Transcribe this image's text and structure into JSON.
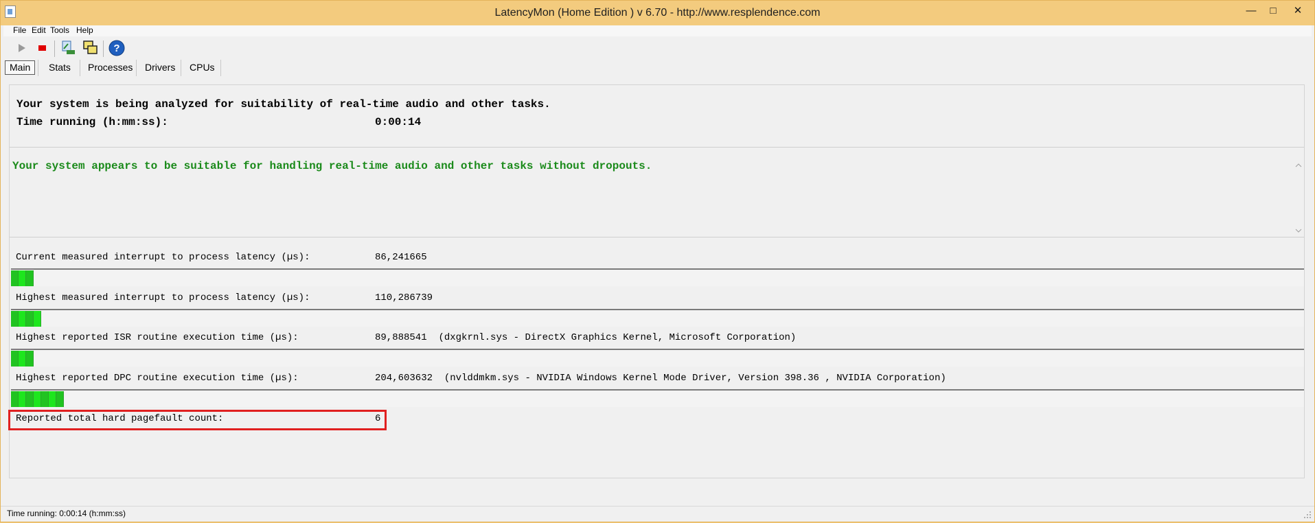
{
  "window": {
    "title": "LatencyMon  (Home Edition )  v 6.70 - http://www.resplendence.com",
    "controls": {
      "minimize": "—",
      "maximize": "□",
      "close": "✕"
    }
  },
  "menu": [
    "File",
    "Edit",
    "Tools",
    "Help"
  ],
  "toolbar": {
    "buttons": [
      "play-icon",
      "stop-icon",
      "gauge-icon",
      "windows-icon",
      "help-icon"
    ],
    "colors": {
      "stop": "#e00000",
      "help": "#1f5fbf",
      "play": "#9a9a9a"
    }
  },
  "tabs": [
    "Main",
    "Stats",
    "Processes",
    "Drivers",
    "CPUs"
  ],
  "header": {
    "line1": "Your system is being analyzed for suitability of real-time audio and other tasks.",
    "time_label": "Time running (h:mm:ss):",
    "time_value": "0:00:14"
  },
  "verdict": {
    "text": "Your system appears to be suitable for handling real-time audio and other tasks without dropouts.",
    "color": "#1a8a1a"
  },
  "metrics": [
    {
      "label": "Current measured interrupt to process latency (µs):",
      "value": "86,241665",
      "detail": "",
      "bar_segments": 3
    },
    {
      "label": "Highest measured interrupt to process latency (µs):",
      "value": "110,286739",
      "detail": "",
      "bar_segments": 4
    },
    {
      "label": "Highest reported ISR routine execution time (µs):",
      "value": "89,888541",
      "detail": "(dxgkrnl.sys - DirectX Graphics Kernel, Microsoft Corporation)",
      "bar_segments": 3
    },
    {
      "label": "Highest reported DPC routine execution time (µs):",
      "value": "204,603632",
      "detail": "(nvlddmkm.sys - NVIDIA Windows Kernel Mode Driver, Version 398.36 , NVIDIA Corporation)",
      "bar_segments": 7
    }
  ],
  "pagefault": {
    "label": "Reported total hard pagefault count:",
    "value": "6",
    "highlight_color": "#e02020"
  },
  "status": {
    "text": "Time running: 0:00:14  (h:mm:ss)"
  }
}
